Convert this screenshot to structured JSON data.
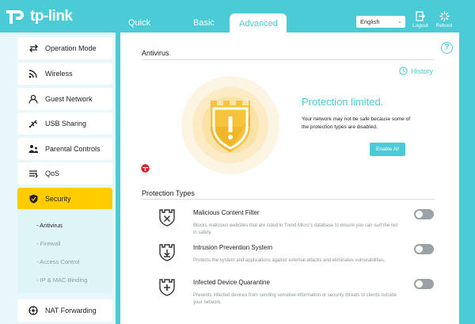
{
  "brand": {
    "name": "tp-link"
  },
  "nav": {
    "tabs": [
      {
        "label": "Quick Setup"
      },
      {
        "label": "Basic"
      },
      {
        "label": "Advanced"
      }
    ]
  },
  "header": {
    "language": "English",
    "logout_label": "Logout",
    "reboot_label": "Reboot"
  },
  "sidebar": {
    "items": [
      {
        "label": "Operation Mode",
        "icon": "operation-mode-icon"
      },
      {
        "label": "Wireless",
        "icon": "wireless-icon"
      },
      {
        "label": "Guest Network",
        "icon": "guest-network-icon"
      },
      {
        "label": "USB Sharing",
        "icon": "usb-icon"
      },
      {
        "label": "Parental Controls",
        "icon": "parental-controls-icon"
      },
      {
        "label": "QoS",
        "icon": "qos-icon"
      },
      {
        "label": "Security",
        "icon": "shield-icon"
      },
      {
        "label": "NAT Forwarding",
        "icon": "nat-forwarding-icon"
      }
    ],
    "security_sub": [
      {
        "label": "- Antivirus"
      },
      {
        "label": "- Firewall"
      },
      {
        "label": "- Access Control"
      },
      {
        "label": "- IP & MAC Binding"
      }
    ]
  },
  "main": {
    "antivirus_title": "Antivirus",
    "history_label": "History",
    "status_title": "Protection limited.",
    "status_desc": "Your network may not be safe because some of the protection types are disabled.",
    "enable_all_label": "Enable All",
    "trend_logo_text": "TREND MICRO",
    "protection_types_title": "Protection Types",
    "protection_types": [
      {
        "name": "Malicious Content Filter",
        "desc": "Blocks malicious websites that are listed in Trend Micro's database to ensure you can surf the net in safety.",
        "enabled": false
      },
      {
        "name": "Intrusion Prevention System",
        "desc": "Protects the system and applications against external attacks and eliminates vulnerabilities.",
        "enabled": false
      },
      {
        "name": "Infected Device Quarantine",
        "desc": "Prevents infected devices from sending sensitive information or security threats to clients outside your network.",
        "enabled": false
      }
    ]
  },
  "colors": {
    "accent": "#4acbd6",
    "active_nav": "#ffcc00",
    "warning": "#f5c43a",
    "toggle_off": "#9aa2a5"
  }
}
